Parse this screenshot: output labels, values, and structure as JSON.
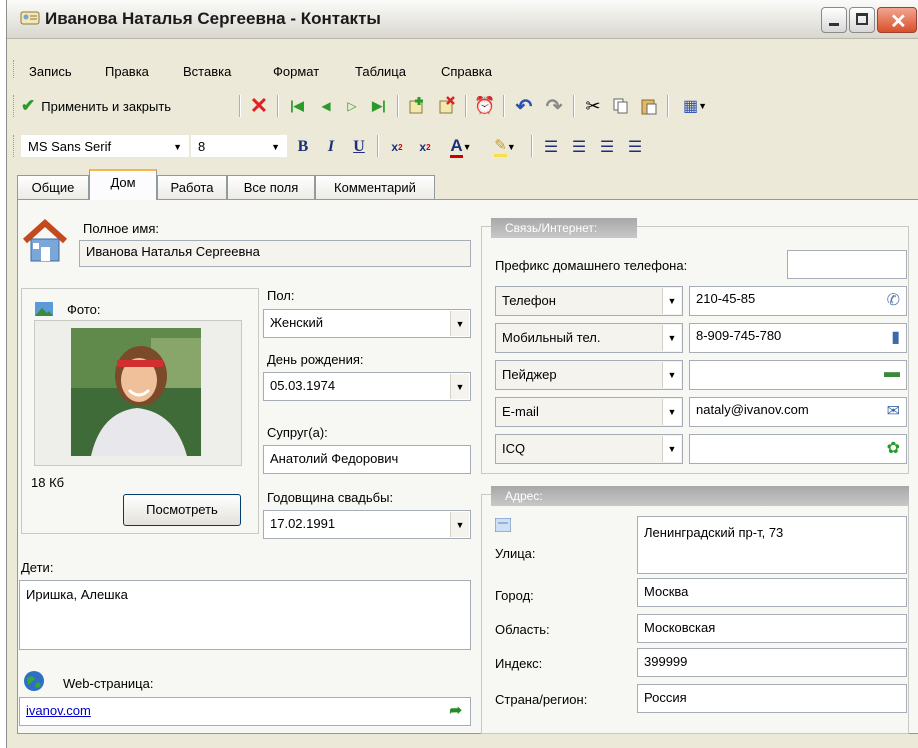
{
  "window": {
    "title": "Иванова Наталья Сергеевна - Контакты"
  },
  "menu": [
    "Запись",
    "Правка",
    "Вставка",
    "Формат",
    "Таблица",
    "Справка"
  ],
  "toolbar": {
    "save_close_label": "Применить и закрыть",
    "font_name": "MS Sans Serif",
    "font_size": "8"
  },
  "tabs": [
    "Общие",
    "Дом",
    "Работа",
    "Все поля",
    "Комментарий"
  ],
  "active_tab": "Дом",
  "form": {
    "full_name_label": "Полное имя:",
    "full_name": "Иванова Наталья Сергеевна",
    "photo_label": "Фото:",
    "photo_size": "18 Кб",
    "view_button": "Посмотреть",
    "gender_label": "Пол:",
    "gender": "Женский",
    "birthday_label": "День рождения:",
    "birthday": "05.03.1974",
    "spouse_label": "Супруг(а):",
    "spouse": "Анатолий Федорович",
    "anniversary_label": "Годовщина свадьбы:",
    "anniversary": "17.02.1991",
    "children_label": "Дети:",
    "children": "Иришка, Алешка",
    "web_label": "Web-страница:",
    "web": "ivanov.com"
  },
  "contact": {
    "group_title": "Связь/Интернет:",
    "home_prefix_label": "Префикс домашнего телефона:",
    "home_prefix": "",
    "rows": [
      {
        "type": "Телефон",
        "value": "210-45-85",
        "icon": "phone-handset-icon"
      },
      {
        "type": "Мобильный тел.",
        "value": "8-909-745-780",
        "icon": "mobile-phone-icon"
      },
      {
        "type": "Пейджер",
        "value": "",
        "icon": "pager-icon"
      },
      {
        "type": "E-mail",
        "value": "nataly@ivanov.com",
        "icon": "envelope-icon"
      },
      {
        "type": "ICQ",
        "value": "",
        "icon": "icq-flower-icon"
      }
    ]
  },
  "address": {
    "group_title": "Адрес:",
    "street_label": "Улица:",
    "street": "Ленинградский пр-т, 73",
    "city_label": "Город:",
    "city": "Москва",
    "region_label": "Область:",
    "region": "Московская",
    "zip_label": "Индекс:",
    "zip": "399999",
    "country_label": "Страна/регион:",
    "country": "Россия"
  },
  "colors": {
    "delete_red": "#e02020",
    "nav_green": "#2a9a2a",
    "link_blue": "#0000cc"
  }
}
